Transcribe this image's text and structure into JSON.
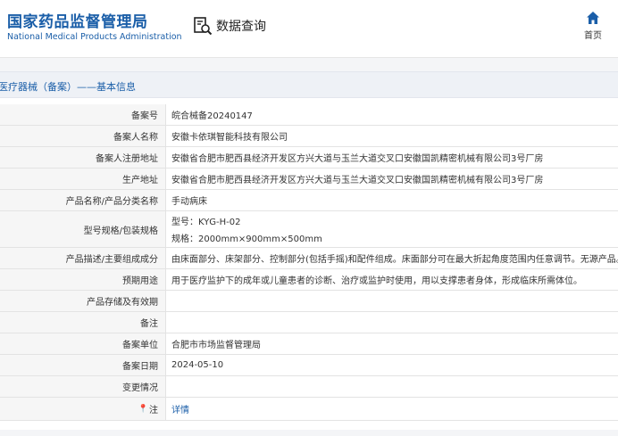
{
  "header": {
    "logo_cn": "国家药品监督管理局",
    "logo_en": "National Medical Products Administration",
    "query_label": "数据查询",
    "home_label": "首页"
  },
  "breadcrumb": "医疗器械（备案）——基本信息",
  "rows": [
    {
      "label": "备案号",
      "value": "皖合械备20240147"
    },
    {
      "label": "备案人名称",
      "value": "安徽卡依琪智能科技有限公司"
    },
    {
      "label": "备案人注册地址",
      "value": "安徽省合肥市肥西县经济开发区方兴大道与玉兰大道交叉口安徽国凯精密机械有限公司3号厂房"
    },
    {
      "label": "生产地址",
      "value": "安徽省合肥市肥西县经济开发区方兴大道与玉兰大道交叉口安徽国凯精密机械有限公司3号厂房"
    },
    {
      "label": "产品名称/产品分类名称",
      "value": "手动病床"
    },
    {
      "label": "型号规格/包装规格",
      "value": "型号：KYG-H-02",
      "value2": "规格：2000mm×900mm×500mm"
    },
    {
      "label": "产品描述/主要组成成分",
      "value": "由床面部分、床架部分、控制部分(包括手摇)和配件组成。床面部分可在最大折起角度范围内任意调节。无源产品。"
    },
    {
      "label": "预期用途",
      "value": "用于医疗监护下的成年或儿童患者的诊断、治疗或监护时使用，用以支撑患者身体，形成临床所需体位。"
    },
    {
      "label": "产品存储及有效期",
      "value": ""
    },
    {
      "label": "备注",
      "value": ""
    },
    {
      "label": "备案单位",
      "value": "合肥市市场监督管理局"
    },
    {
      "label": "备案日期",
      "value": "2024-05-10"
    },
    {
      "label": "变更情况",
      "value": ""
    },
    {
      "label": "注",
      "value": "详情"
    }
  ]
}
